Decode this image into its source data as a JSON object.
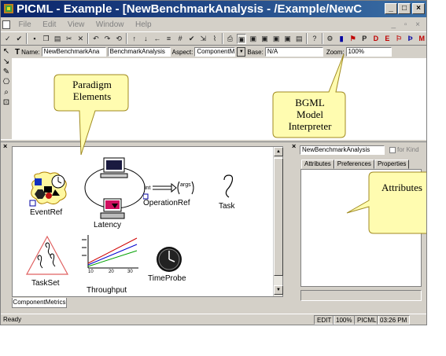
{
  "window": {
    "title": "PICML - Example - [NewBenchmarkAnalysis - /Example/NewC",
    "minimize": "_",
    "maximize": "□",
    "close": "×"
  },
  "menubar": {
    "items": [
      "File",
      "Edit",
      "View",
      "Window",
      "Help"
    ],
    "mdi_controls": "_ ▫ ×"
  },
  "toolbar": {
    "letter_buttons": [
      "P",
      "D",
      "E"
    ]
  },
  "namebar": {
    "name_label": "Name:",
    "name_value": "NewBenchmarkAna",
    "kind_value": "BenchmarkAnalysis",
    "aspect_label": "Aspect:",
    "aspect_value": "ComponentMe",
    "base_label": "Base:",
    "base_value": "N/A",
    "zoom_label": "Zoom:",
    "zoom_value": "100%"
  },
  "callouts": {
    "paradigm": [
      "Paradigm",
      "Elements"
    ],
    "interpreter": [
      "BGML",
      "Model",
      "Interpreter"
    ],
    "attributes": [
      "Attributes"
    ]
  },
  "parts": {
    "eventref": "EventRef",
    "latency": "Latency",
    "operationref": "OperationRef",
    "operationref_args": "args",
    "task": "Task",
    "taskset": "TaskSet",
    "throughput": "Throughput",
    "throughput_ticks": [
      "10",
      "20",
      "30"
    ],
    "timeprobe": "TimeProbe",
    "tab": "ComponentMetrics"
  },
  "object_panel": {
    "object_name": "NewBenchmarkAnalysis",
    "for_kind": "for Kind",
    "tabs": [
      "Attributes",
      "Preferences",
      "Properties"
    ]
  },
  "statusbar": {
    "status": "Ready",
    "mode": "EDIT",
    "zoom": "100%",
    "paradigm": "PICML",
    "time": "03:26 PM"
  },
  "colors": {
    "title_start": "#0a246a",
    "title_end": "#3a6ea5",
    "callout_fill": "#fffcb0",
    "callout_border": "#a08a20"
  }
}
